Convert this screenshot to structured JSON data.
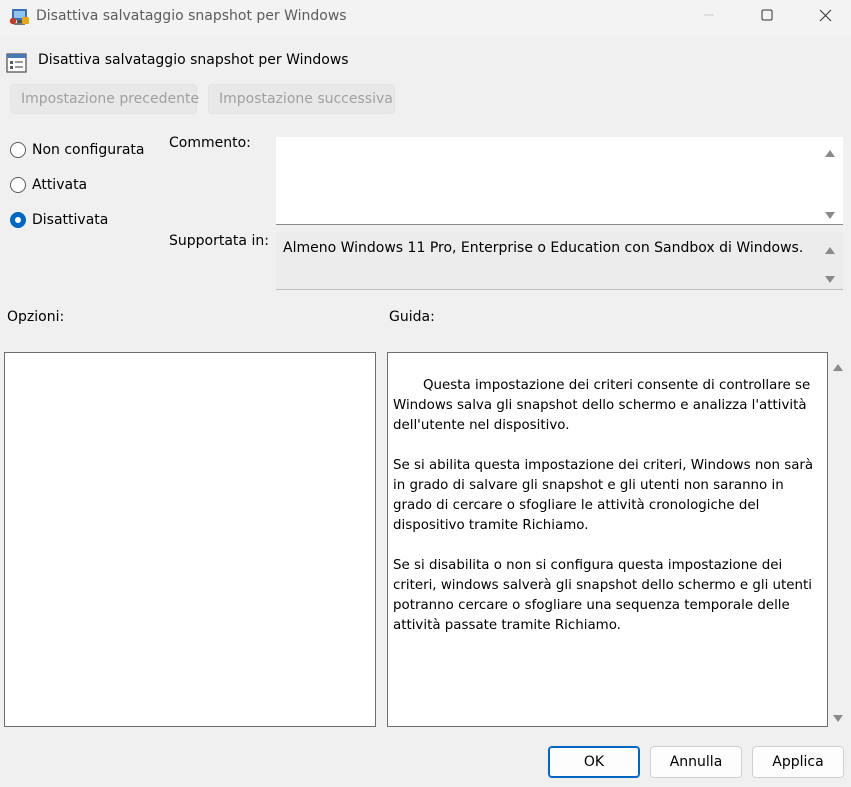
{
  "window": {
    "title": "Disattiva salvataggio snapshot per Windows",
    "icon": "group-policy-app-icon",
    "controls": {
      "minimize_icon": "minimize-icon",
      "maximize_icon": "maximize-icon",
      "close_icon": "close-icon"
    }
  },
  "header": {
    "policy_icon": "policy-setting-icon",
    "policy_title": "Disattiva salvataggio snapshot per Windows",
    "prev_label": "Impostazione precedente",
    "next_label": "Impostazione successiva"
  },
  "state": {
    "options": [
      {
        "label": "Non configurata",
        "selected": false
      },
      {
        "label": "Attivata",
        "selected": false
      },
      {
        "label": "Disattivata",
        "selected": true
      }
    ]
  },
  "comment": {
    "label": "Commento:",
    "value": ""
  },
  "supported": {
    "label": "Supportata in:",
    "value": "Almeno Windows 11 Pro, Enterprise o Education con Sandbox di Windows."
  },
  "options_section": {
    "label": "Opzioni:"
  },
  "help_section": {
    "label": "Guida:",
    "paragraphs": [
      "Questa impostazione dei criteri consente di controllare se Windows salva gli snapshot dello schermo e analizza l'attività dell'utente nel dispositivo.",
      "Se si abilita questa impostazione dei criteri, Windows non sarà in grado di salvare gli snapshot e gli utenti non saranno in grado di cercare o sfogliare le attività cronologiche del dispositivo tramite Richiamo.",
      "Se si disabilita o non si configura questa impostazione dei criteri, windows salverà gli snapshot dello schermo e gli utenti potranno cercare o sfogliare una sequenza temporale delle attività passate tramite Richiamo."
    ]
  },
  "buttons": {
    "ok": "OK",
    "cancel": "Annulla",
    "apply": "Applica"
  },
  "colors": {
    "accent": "#0067c0",
    "dialog_bg": "#f0f0f0"
  }
}
